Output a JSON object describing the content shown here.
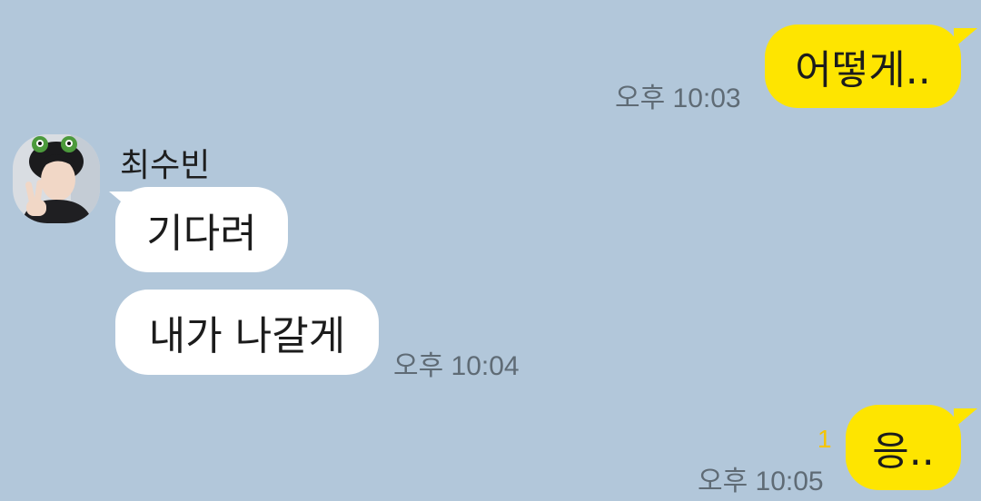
{
  "messages": [
    {
      "direction": "sent",
      "text": "어떻게..",
      "time": "오후 10:03"
    },
    {
      "direction": "received",
      "sender": "최수빈",
      "text": "기다려"
    },
    {
      "direction": "received",
      "text": "내가 나갈게",
      "time": "오후 10:04"
    },
    {
      "direction": "sent",
      "text": "응..",
      "time": "오후 10:05",
      "unread_count": "1"
    }
  ],
  "colors": {
    "background": "#b2c7da",
    "sent_bubble": "#fee500",
    "received_bubble": "#ffffff",
    "timestamp": "#5f6b75",
    "unread": "#f5c400"
  },
  "icons": {
    "avatar": "profile-photo"
  }
}
